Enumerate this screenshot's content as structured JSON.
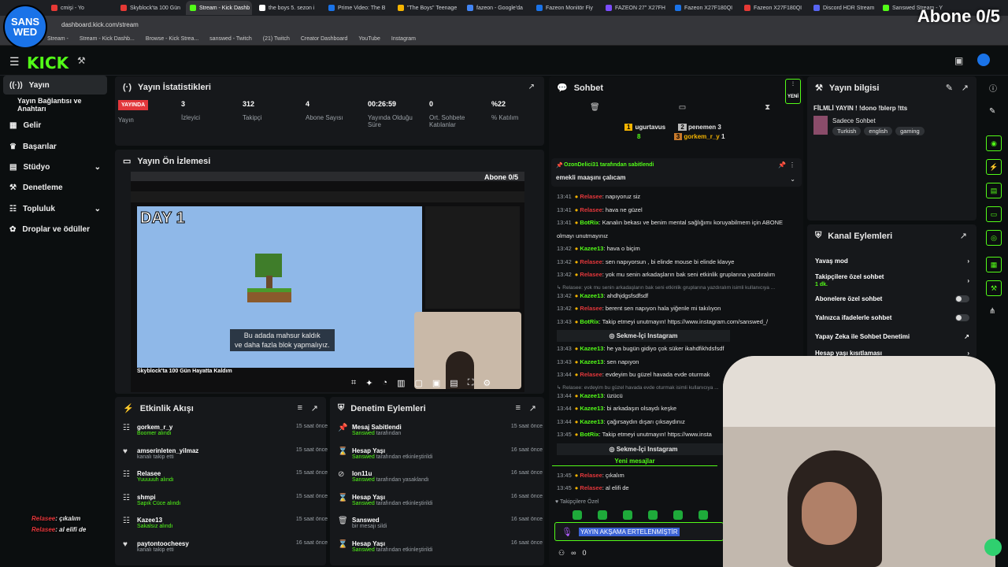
{
  "browser": {
    "tabs": [
      "cmişi - Yo",
      "Skyblock'ta 100 Gün",
      "Stream - Kick Dashb",
      "the boys 5. sezon i",
      "Prime Video: The B",
      "\"The Boys\" Teenage",
      "fazeon - Google'da",
      "Fazeon Monitör Fiy",
      "FAZEON 27\" X27FH",
      "Fazeon X27F180QI",
      "Fazeon X27F180QI",
      "Discord HDR Stream",
      "Sanswed Stream - Y"
    ],
    "url": "dashboard.kick.com/stream",
    "bookmarks": [
      "Stream -",
      "Stream - Kick Dashb...",
      "Browse - Kick Strea...",
      "sanswed - Twitch",
      "(21) Twitch",
      "Creator Dashboard",
      "YouTube",
      "Instagram"
    ]
  },
  "overlay": {
    "logo_top": "SANS",
    "logo_bottom": "WED",
    "abone": "Abone 0/5",
    "left_chat": [
      {
        "user": "Relasee",
        "text": ": çıkalım"
      },
      {
        "user": "Relasee",
        "text": ": al elifi de"
      }
    ]
  },
  "brand": "KICK",
  "sidebar": [
    {
      "label": "Yayın",
      "icon": "broadcast-icon"
    },
    {
      "label": "Yayın Bağlantısı ve Anahtarı",
      "icon": ""
    },
    {
      "label": "Gelir",
      "icon": "money-icon"
    },
    {
      "label": "Başarılar",
      "icon": "trophy-icon"
    },
    {
      "label": "Stüdyo",
      "icon": "grid-icon"
    },
    {
      "label": "Denetleme",
      "icon": "hammer-icon"
    },
    {
      "label": "Topluluk",
      "icon": "users-icon"
    },
    {
      "label": "Droplar ve ödüller",
      "icon": "gift-icon"
    }
  ],
  "stats": {
    "title": "Yayın İstatistikleri",
    "live": "YAYINDA",
    "live_label": "Yayın",
    "items": [
      {
        "value": "3",
        "label": "İzleyici"
      },
      {
        "value": "312",
        "label": "Takipçi"
      },
      {
        "value": "4",
        "label": "Abone Sayısı"
      },
      {
        "value": "00:26:59",
        "label": "Yayında Olduğu Süre"
      },
      {
        "value": "0",
        "label": "Ort. Sohbete Katılanlar"
      },
      {
        "value": "%22",
        "label": "% Katılım"
      }
    ]
  },
  "preview": {
    "title": "Yayın Ön İzlemesi",
    "video_title": "DAY 1",
    "subtitle_1": "Bu adada mahsur kaldık",
    "subtitle_2": "ve daha fazla blok yapmalıyız.",
    "yt_caption": "Skyblock'ta 100 Gün Hayatta Kaldım",
    "abone_small": "Abone 0/5"
  },
  "activity": {
    "title": "Etkinlik Akışı",
    "items": [
      {
        "name": "gorkem_r_y",
        "sub": "Boomer alındı",
        "time": "15 saat önce"
      },
      {
        "name": "amserinleten_yilmaz",
        "sub": "kanalı takip etti",
        "time": "15 saat önce"
      },
      {
        "name": "Relasee",
        "sub": "Yuuuuuh alındı",
        "time": "15 saat önce"
      },
      {
        "name": "shmpi",
        "sub": "Sapık Cüce alındı",
        "time": "15 saat önce"
      },
      {
        "name": "Kazee13",
        "sub": "Sakalsız alındı",
        "time": "15 saat önce"
      },
      {
        "name": "paytontoocheesy",
        "sub": "kanalı takip etti",
        "time": "16 saat önce"
      }
    ]
  },
  "moderation": {
    "title": "Denetim Eylemleri",
    "items": [
      {
        "name": "Mesaj Sabitlendi",
        "sub": "Sanswed tarafından",
        "time": "15 saat önce"
      },
      {
        "name": "Hesap Yaşı",
        "sub": "Sanswed tarafından etkinleştirildi",
        "time": "16 saat önce"
      },
      {
        "name": "lon11u",
        "sub": "Sanswed tarafından yasaklandı",
        "time": "16 saat önce"
      },
      {
        "name": "Hesap Yaşı",
        "sub": "Sanswed tarafından etkinleştirildi",
        "time": "16 saat önce"
      },
      {
        "name": "Sanswed",
        "sub": "bir mesajı sildi",
        "time": "16 saat önce"
      },
      {
        "name": "Hesap Yaşı",
        "sub": "Sanswed tarafından etkinleştirildi",
        "time": "16 saat önce"
      }
    ]
  },
  "chat": {
    "title": "Sohbet",
    "new_label": "YENİ",
    "top_users": [
      {
        "name": "ugurtavus",
        "count": "8"
      },
      {
        "name": "penemen",
        "count": "3"
      },
      {
        "name": "gorkem_r_y",
        "count": "1"
      }
    ],
    "pinned_by": "OzonDelici31 tarafından sabitlendi",
    "pinned_text": "emekli maaşını çalıcam",
    "messages": [
      {
        "time": "13:41",
        "user": "Relasee",
        "text": ": napıyoruz siz",
        "c": "red"
      },
      {
        "time": "13:41",
        "user": "Relasee",
        "text": ": hava ne güzel",
        "c": "red"
      },
      {
        "time": "13:41",
        "user": "BotRix",
        "text": ": Kanalın bekası ve benim mental sağlığımı koruyabilmem için ABONE",
        "c": "teal"
      },
      {
        "time": "",
        "user": "",
        "text": "olmayı unutmayınız",
        "c": ""
      },
      {
        "time": "13:42",
        "user": "Kazee13",
        "text": ": hava o biçim",
        "c": "teal"
      },
      {
        "time": "13:42",
        "user": "Relasee",
        "text": ": sen napıyorsun , bi elinde mouse bi elinde klavye",
        "c": "red"
      },
      {
        "time": "13:42",
        "user": "Relasee",
        "text": ": yok mu senin arkadaşların bak seni etkinlik gruplarına yazdıralım",
        "c": "red"
      },
      {
        "time": "",
        "user": "",
        "text": "↳ Relasee: yok mu senin arkadaşların bak seni etkinlik gruplarına yazdıralım isimli kullanıcıya ...",
        "c": "m"
      },
      {
        "time": "13:42",
        "user": "Kazee13",
        "text": ": ahdhjdgsfsdfsdf",
        "c": "teal"
      },
      {
        "time": "13:42",
        "user": "Relasee",
        "text": ": berent sen napıyon hala yiğenle mi takılıyon",
        "c": "red"
      },
      {
        "time": "13:43",
        "user": "BotRix",
        "text": ": Takip etmeyi unutmayın! https://www.instagram.com/sanswed_/",
        "c": "teal"
      },
      {
        "time": "",
        "user": "",
        "text": "Sekme-İçi Instagram",
        "c": "btn"
      },
      {
        "time": "13:43",
        "user": "Kazee13",
        "text": ": he ya bugün gidiyo çok süker ikahdfikhdsfsdf",
        "c": "teal"
      },
      {
        "time": "13:43",
        "user": "Kazee13",
        "text": ": sen napıyon",
        "c": "teal"
      },
      {
        "time": "13:44",
        "user": "Relasee",
        "text": ": evdeyim bu güzel havada evde oturmak",
        "c": "red"
      },
      {
        "time": "",
        "user": "",
        "text": "↳ Relasee: evdeyim bu güzel havada evde oturmak isimli kullanıcıya ...",
        "c": "m"
      },
      {
        "time": "13:44",
        "user": "Kazee13",
        "text": ": üzücü",
        "c": "teal"
      },
      {
        "time": "13:44",
        "user": "Kazee13",
        "text": ": bi arkadaşın olsaydı keşke",
        "c": "teal"
      },
      {
        "time": "13:44",
        "user": "Kazee13",
        "text": ": çağırsaydın dışarı çıksaydınız",
        "c": "teal"
      },
      {
        "time": "13:45",
        "user": "BotRix",
        "text": ": Takip etmeyi unutmayın! https://www.insta",
        "c": "teal"
      },
      {
        "time": "",
        "user": "",
        "text": "Sekme-İçi Instagram",
        "c": "btn"
      }
    ],
    "new_messages": "Yeni mesajlar",
    "recent": [
      {
        "time": "13:45",
        "user": "Relasee",
        "text": ": çıkalım"
      },
      {
        "time": "13:45",
        "user": "Relasee",
        "text": ": al elifi de"
      }
    ],
    "followers_only": "Takipçilere Özel",
    "input_value": "YAYIN AKŞAMA ERTELENMİŞTİR",
    "footer_count": "0"
  },
  "info": {
    "title": "Yayın bilgisi",
    "stream_title": "FİLMLİ YAYIN ! !dono !blerp !tts",
    "category": "Sadece Sohbet",
    "tags": [
      "Turkish",
      "english",
      "gaming"
    ]
  },
  "actions": {
    "title": "Kanal Eylemleri",
    "slow": "Yavaş mod",
    "followers": "Takipçilere özel sohbet",
    "followers_sub": "1 dk.",
    "subs": "Abonelere özel sohbet",
    "emotes": "Yalnızca ifadelerle sohbet",
    "ai": "Yapay Zeka ile Sohbet Denetimi",
    "age": "Hesap yaşı kısıtlaması"
  }
}
